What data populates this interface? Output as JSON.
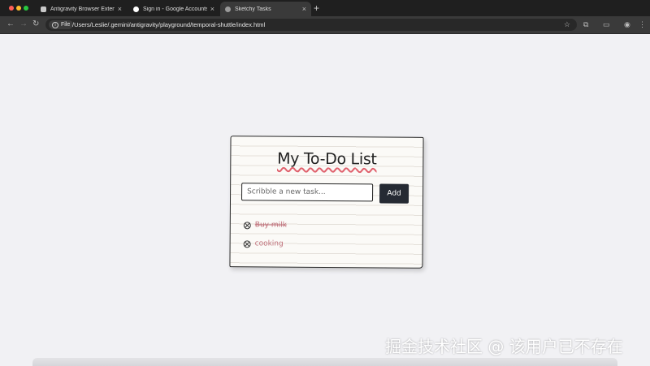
{
  "browser": {
    "tabs": [
      {
        "title": "Antigravity Browser Extensio",
        "active": false
      },
      {
        "title": "Sign in - Google Accounts",
        "active": false
      },
      {
        "title": "Sketchy Tasks",
        "active": true
      }
    ],
    "address": {
      "chip_label": "File",
      "url": "/Users/Leslie/.gemini/antigravity/playground/temporal-shuttle/index.html"
    }
  },
  "app": {
    "title": "My To-Do List",
    "input_placeholder": "Scribble a new task...",
    "add_label": "Add",
    "tasks": [
      {
        "text": "Buy milk",
        "completed": true
      },
      {
        "text": "cooking",
        "completed": false
      }
    ]
  },
  "watermark": "掘金技术社区 @ 该用户已不存在",
  "colors": {
    "accent_red": "#e0626e",
    "button_dark": "#252a33",
    "task_text": "#c0707a"
  }
}
